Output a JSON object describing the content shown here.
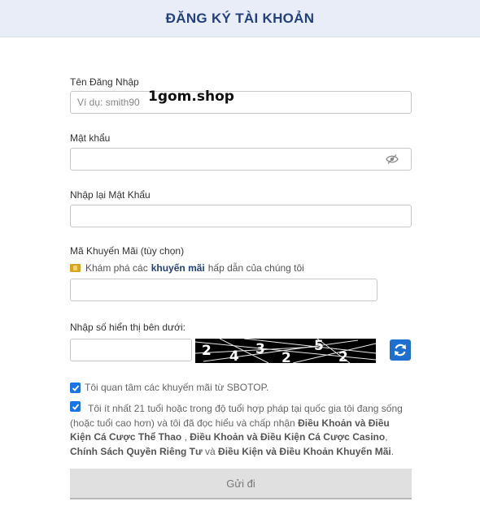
{
  "header": {
    "title": "ĐĂNG KÝ TÀI KHOẢN"
  },
  "username": {
    "label": "Tên Đăng Nhập",
    "placeholder": "Ví dụ: smith90",
    "value": ""
  },
  "watermark": "1gom.shop",
  "password": {
    "label": "Mật khẩu",
    "value": "",
    "icon": "eye-icon"
  },
  "confirm_password": {
    "label": "Nhập lại Mật Khẩu",
    "value": ""
  },
  "promo": {
    "label": "Mã Khuyến Mãi (tùy chọn)",
    "hint_prefix": "Khám phá các",
    "hint_link": "khuyến mãi",
    "hint_suffix": "hấp dẫn của chúng tôi",
    "value": ""
  },
  "captcha": {
    "label": "Nhập số hiển thị bên dưới:",
    "value": "",
    "digits": [
      "2",
      "4",
      "3",
      "2",
      "5",
      "2"
    ]
  },
  "checkbox_promo": {
    "checked": true,
    "text": "Tôi quan tâm các khuyến mãi từ SBOTOP."
  },
  "checkbox_terms": {
    "checked": true,
    "part1": "Tôi ít nhất 21 tuổi hoặc trong độ tuổi hợp pháp tại quốc gia tôi đang sống (hoặc tuổi cao hơn) và tôi đã đọc hiểu và chấp nhận",
    "link1": "Điều Khoản và Điều Kiện Cá Cược Thể Thao",
    "sep1": " , ",
    "link2": "Điều Khoản và Điều Kiện Cá Cược Casino",
    "sep2": ", ",
    "link3": "Chính Sách Quyền Riêng Tư",
    "sep3": " và ",
    "link4": "Điều Kiện và Điều Khoản Khuyến Mãi",
    "end": "."
  },
  "submit": {
    "label": "Gửi đi"
  },
  "colors": {
    "accent": "#1a73e8",
    "title": "#24407c",
    "header_bg": "#e9edf8"
  }
}
